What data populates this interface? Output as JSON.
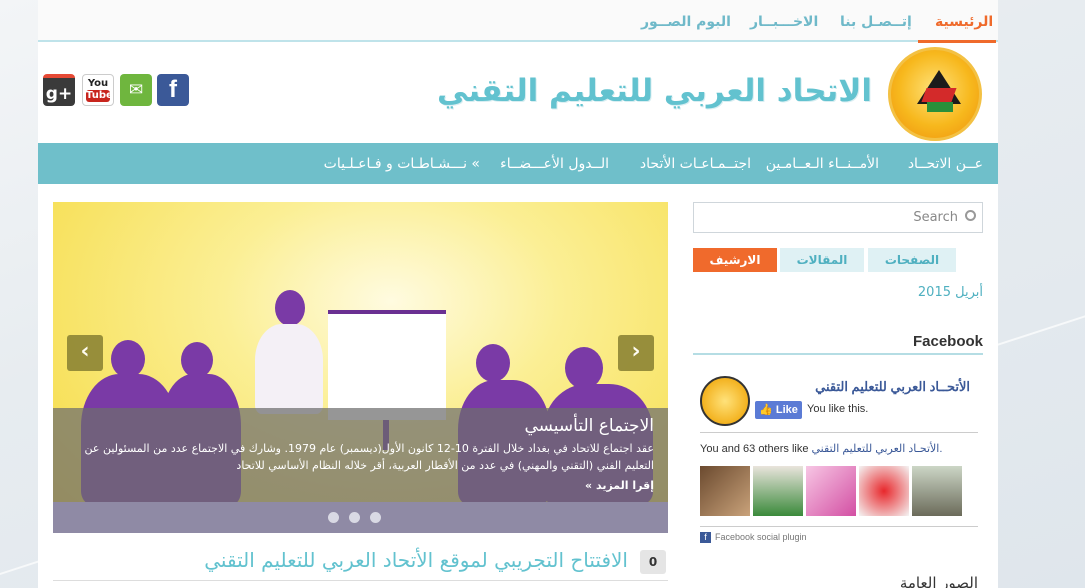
{
  "toplinks": {
    "home": "الرئيسية",
    "contact": "إتــصـل بنا",
    "news": "الاخـــبــار",
    "album": "البوم الصــور"
  },
  "header": {
    "site_title": "الاتحاد العربي للتعليم التقني",
    "social": {
      "google": "g+",
      "youtube_top": "You",
      "youtube_bottom": "Tube",
      "mail": "✉",
      "facebook": "f"
    }
  },
  "nav": {
    "about": "عــن الاتحــاد",
    "secretaries": "الأمــنــاء الـعــامـين",
    "meetings": "اجتــمـاعـات الأتحاد",
    "members": "الــدول الأعـــضــاء",
    "activities": "» نـــشـاطـات و فـاعـلـيات"
  },
  "slider": {
    "title": "الاجتماع التأسيسي",
    "text": "عقد اجتماع للاتحاد في بغداد خلال الفترة 10-12 كانون الأول(ديسمبر) عام 1979. وشارك في الاجتماع عدد من المسئولين عن التعليم الفني (التقني والمهني) في عدد من الأقطار العربية، أقر خلاله النظام الأساسي للاتحاد",
    "read_more": "إقرا المزيد »",
    "prev": "‹",
    "next": "›"
  },
  "post": {
    "comments": "0",
    "title": "الافتتاح التجريبي لموقع الأتحاد العربي للتعليم التقني"
  },
  "sidebar": {
    "search_placeholder": "Search",
    "tabs": {
      "pages": "الصفحات",
      "articles": "المقالات",
      "archive": "الارشيف"
    },
    "archive_month": "أبريل 2015",
    "facebook_heading": "Facebook",
    "fb_page_name": "الأتحــاد العربي للتعليم التقني",
    "like_label": "Like",
    "you_like": "You like this.",
    "others_prefix": "You and 63 others like ",
    "others_page": "الأتحـاد العربي للتعليم التقني.",
    "plugin": "Facebook social plugin",
    "bottom_heading": "الصور العامة"
  }
}
